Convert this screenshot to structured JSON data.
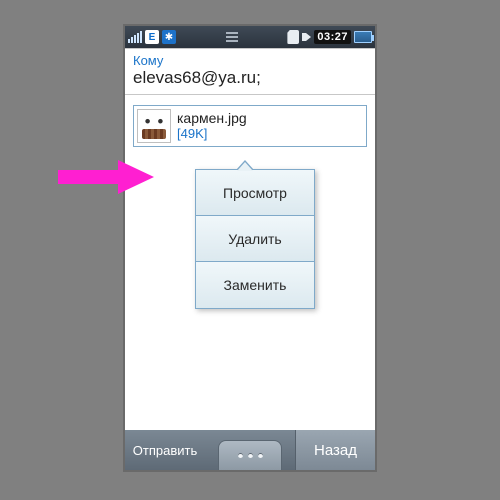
{
  "status": {
    "network_badge": "E",
    "bluetooth_glyph": "✱",
    "clock": "03:27"
  },
  "compose": {
    "to_label": "Кому",
    "to_value": "elevas68@ya.ru;"
  },
  "attachment": {
    "filename": "кармен.jpg",
    "size": "[49K]"
  },
  "menu": {
    "view": "Просмотр",
    "delete": "Удалить",
    "replace": "Заменить"
  },
  "softkeys": {
    "left": "Отправить",
    "right": "Назад"
  }
}
